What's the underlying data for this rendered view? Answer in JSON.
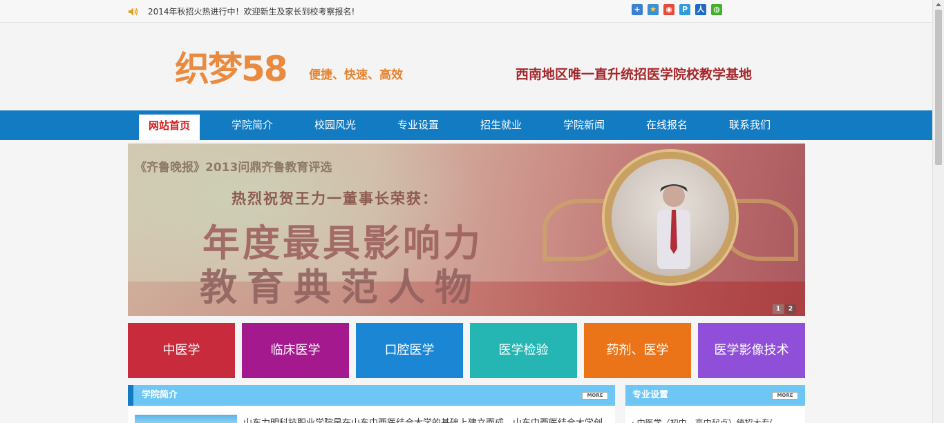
{
  "topbar": {
    "notice": "2014年秋招火热进行中！欢迎新生及家长到校考察报名!",
    "share_icons": [
      {
        "name": "add-share-icon",
        "glyph": "+",
        "color": "#3a7fd0"
      },
      {
        "name": "qzone-share-icon",
        "glyph": "★",
        "color": "#3c8fd6"
      },
      {
        "name": "weibo-share-icon",
        "glyph": "◉",
        "color": "#e54b38"
      },
      {
        "name": "tencent-weibo-share-icon",
        "glyph": "P",
        "color": "#2f9be0"
      },
      {
        "name": "renren-share-icon",
        "glyph": "人",
        "color": "#1e6ac2"
      },
      {
        "name": "wechat-share-icon",
        "glyph": "◍",
        "color": "#43b02a"
      }
    ]
  },
  "header": {
    "logo": "织梦58",
    "slogan": "便捷、快速、高效",
    "base_title": "西南地区唯一直升统招医学院校教学基地"
  },
  "nav": {
    "items": [
      {
        "label": "网站首页",
        "active": true
      },
      {
        "label": "学院简介"
      },
      {
        "label": "校园风光"
      },
      {
        "label": "专业设置"
      },
      {
        "label": "招生就业"
      },
      {
        "label": "学院新闻"
      },
      {
        "label": "在线报名"
      },
      {
        "label": "联系我们"
      }
    ]
  },
  "banner": {
    "line1": "《齐鲁晚报》2013问鼎齐鲁教育评选",
    "line2": "热烈祝贺王力一董事长荣获：",
    "line3": "年度最具影响力",
    "line4": "教育典范人物",
    "dots": [
      "1",
      "2"
    ]
  },
  "majors": [
    {
      "label": "中医学",
      "color": "#c82b3c"
    },
    {
      "label": "临床医学",
      "color": "#a5198f"
    },
    {
      "label": "口腔医学",
      "color": "#1a86d4"
    },
    {
      "label": "医学检验",
      "color": "#25b5b2"
    },
    {
      "label": "药剂、医学",
      "color": "#ec7418"
    },
    {
      "label": "医学影像技术",
      "color": "#8f4fd8"
    }
  ],
  "sections": {
    "intro": {
      "title": "学院简介",
      "more": "MORE",
      "text": "山东力明科技职业学院是在山东中西医结合大学的基础上建立而成，山东中西医结合大学创建于"
    },
    "majors": {
      "title": "专业设置",
      "more": "MORE",
      "first_item": "· 中医学（初中、高中起点）统招大专("
    }
  }
}
